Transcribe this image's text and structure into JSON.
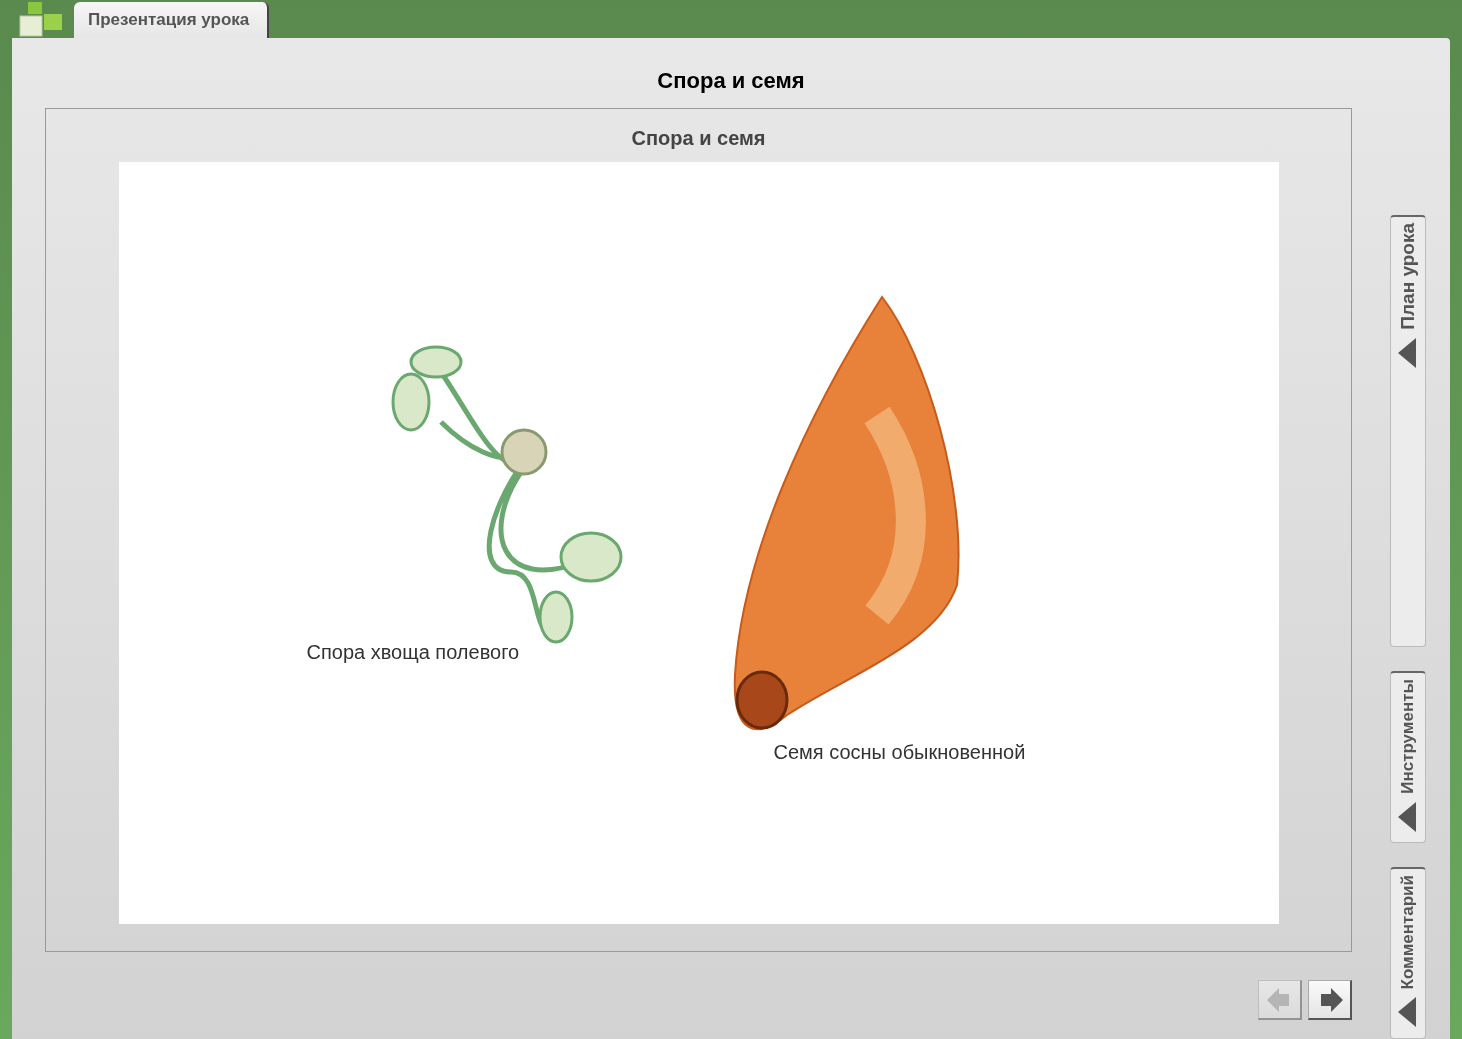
{
  "app_tab": {
    "label": "Презентация урока",
    "selected": true
  },
  "page_title": "Спора и семя",
  "slide": {
    "title": "Спора и семя",
    "captions": [
      {
        "kind": "spore",
        "text": "Спора хвоща полевого"
      },
      {
        "kind": "seed",
        "text": "Семя сосны обыкновенной"
      }
    ]
  },
  "side_tabs": [
    {
      "label": "План урока",
      "kind": "tall"
    },
    {
      "label": "Инструменты",
      "kind": "short"
    },
    {
      "label": "Комментарий",
      "kind": "short"
    }
  ],
  "nav": [
    {
      "kind": "prev",
      "disabled": true
    },
    {
      "kind": "next",
      "disabled": false
    }
  ]
}
